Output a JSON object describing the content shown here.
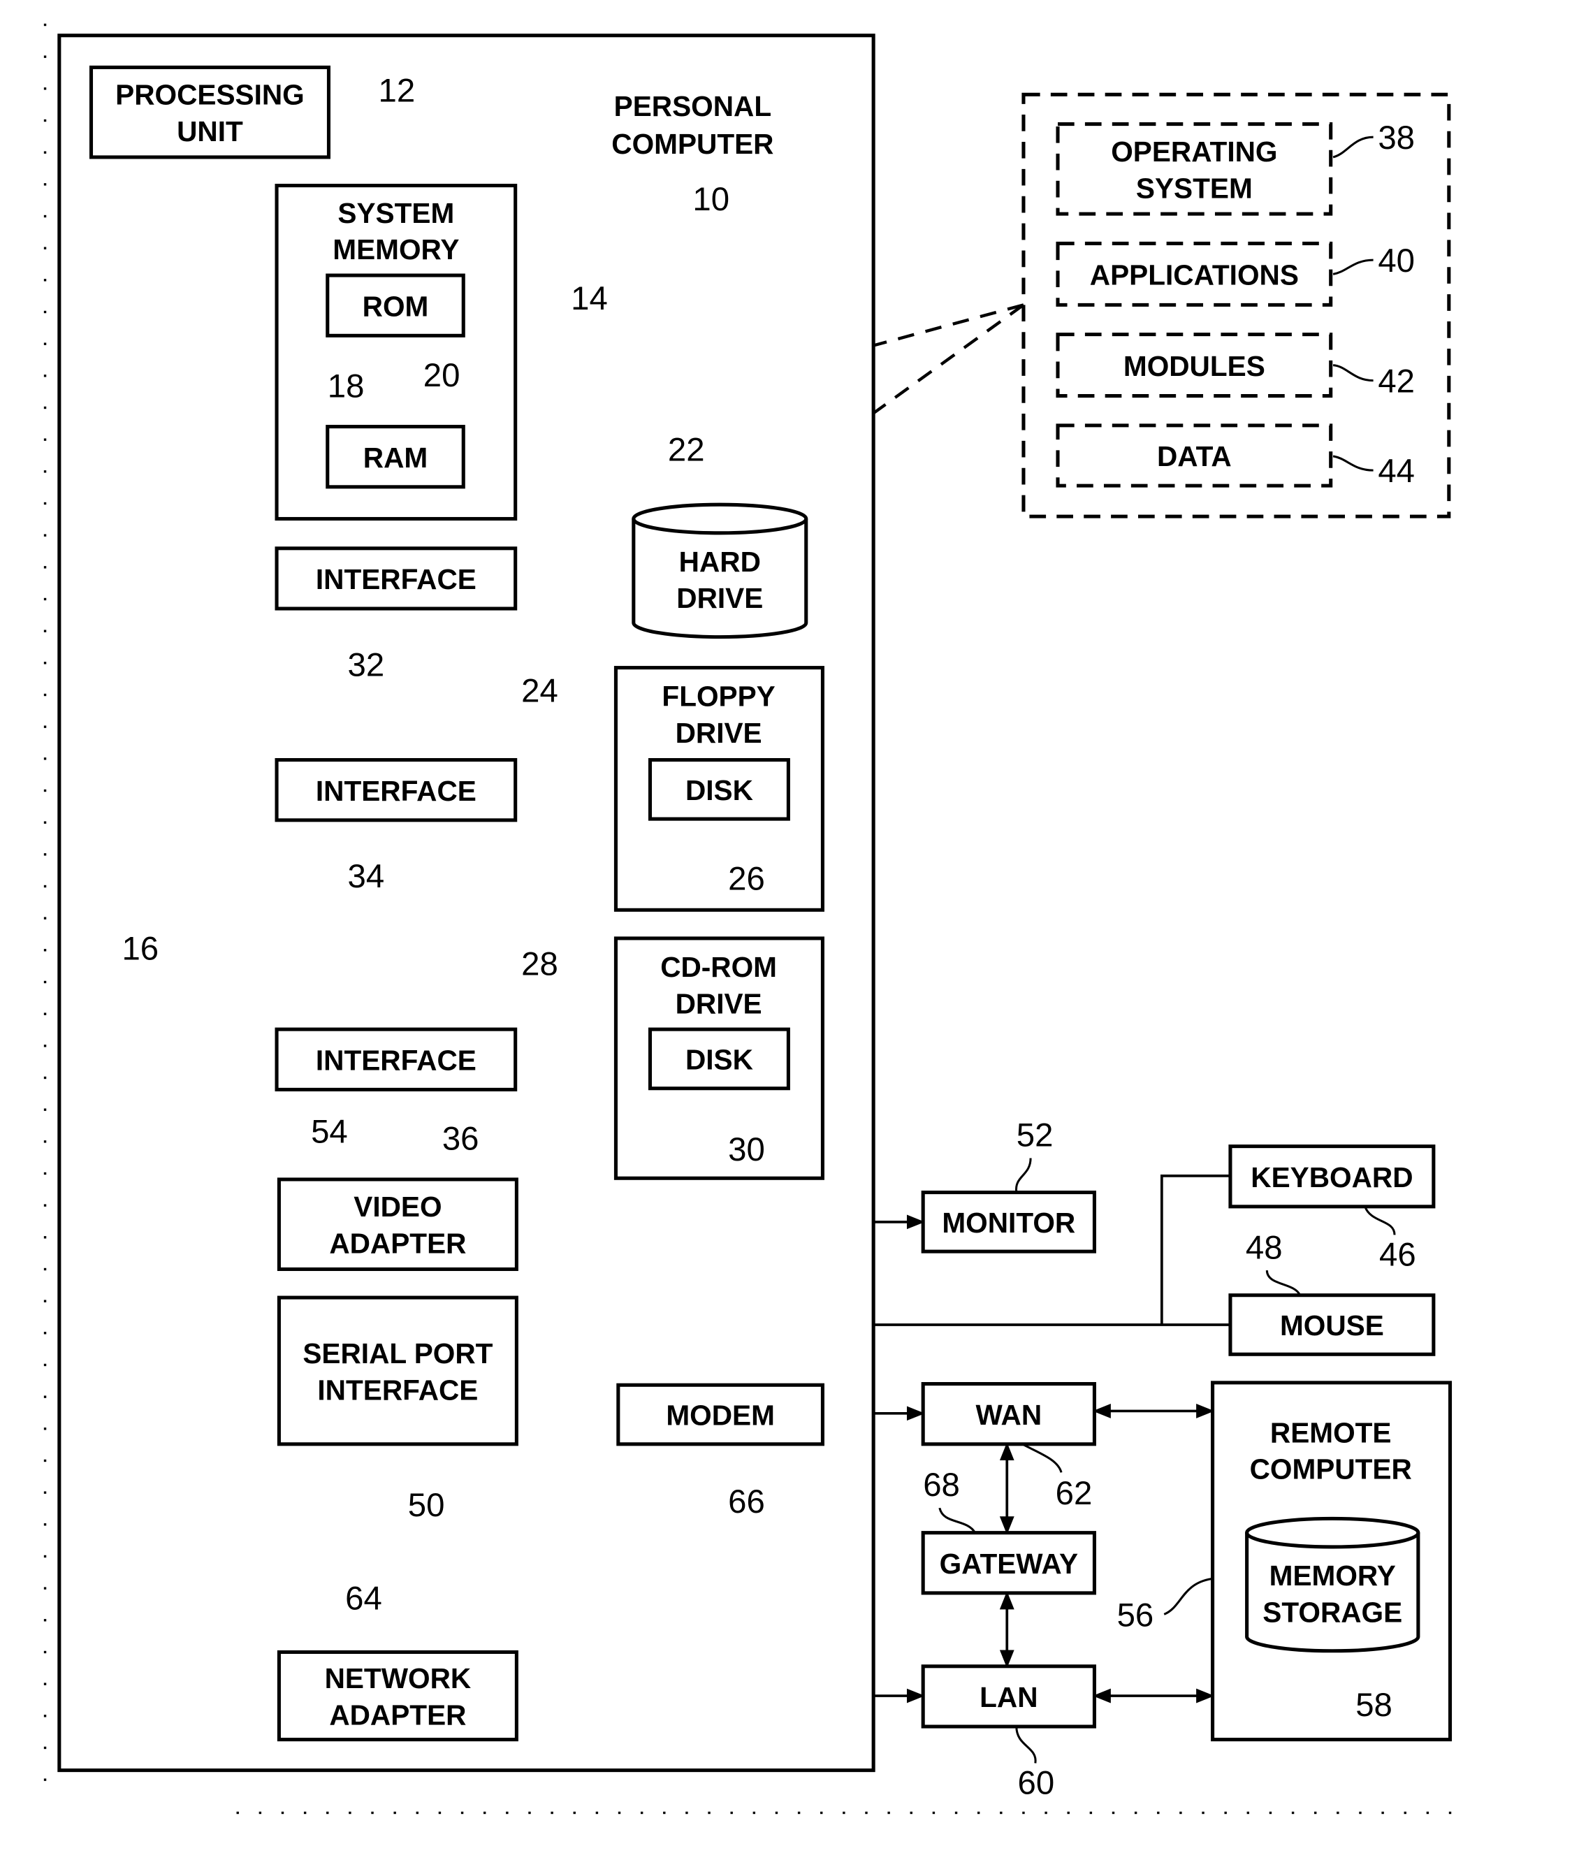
{
  "figure": {
    "title": "PERSONAL COMPUTER",
    "title_ref": "10",
    "blocks": {
      "processing_unit": {
        "label": [
          "PROCESSING",
          "UNIT"
        ],
        "ref": "12"
      },
      "system_memory": {
        "label": [
          "SYSTEM",
          "MEMORY"
        ],
        "ref": "14"
      },
      "rom": {
        "label": [
          "ROM"
        ],
        "ref": "18"
      },
      "ram": {
        "label": [
          "RAM"
        ],
        "ref": "20"
      },
      "system_bus": {
        "ref": "16"
      },
      "hard_drive": {
        "label": [
          "HARD",
          "DRIVE"
        ],
        "ref": "22"
      },
      "interface_hd": {
        "label": [
          "INTERFACE"
        ],
        "ref": "32"
      },
      "floppy_drive": {
        "label": [
          "FLOPPY",
          "DRIVE"
        ],
        "ref": "24"
      },
      "floppy_disk": {
        "label": [
          "DISK"
        ],
        "ref": "26"
      },
      "interface_floppy": {
        "label": [
          "INTERFACE"
        ],
        "ref": "34"
      },
      "cdrom_drive": {
        "label": [
          "CD-ROM",
          "DRIVE"
        ],
        "ref": "28"
      },
      "cdrom_disk": {
        "label": [
          "DISK"
        ],
        "ref": "30"
      },
      "interface_cdrom": {
        "label": [
          "INTERFACE"
        ],
        "ref": "36"
      },
      "video_adapter": {
        "label": [
          "VIDEO",
          "ADAPTER"
        ],
        "ref": "54"
      },
      "monitor": {
        "label": [
          "MONITOR"
        ],
        "ref": "52"
      },
      "serial_port_interface": {
        "label": [
          "SERIAL PORT",
          "INTERFACE"
        ],
        "ref": "50"
      },
      "keyboard": {
        "label": [
          "KEYBOARD"
        ],
        "ref": "46"
      },
      "mouse": {
        "label": [
          "MOUSE"
        ],
        "ref": "48"
      },
      "modem": {
        "label": [
          "MODEM"
        ],
        "ref": "66"
      },
      "wan": {
        "label": [
          "WAN"
        ],
        "ref": "62"
      },
      "gateway": {
        "label": [
          "GATEWAY"
        ],
        "ref": "68"
      },
      "lan": {
        "label": [
          "LAN"
        ],
        "ref": "60"
      },
      "network_adapter": {
        "label": [
          "NETWORK",
          "ADAPTER"
        ],
        "ref": "64"
      },
      "remote_computer": {
        "label": [
          "REMOTE",
          "COMPUTER"
        ],
        "ref": "56"
      },
      "memory_storage": {
        "label": [
          "MEMORY",
          "STORAGE"
        ],
        "ref": "58"
      },
      "operating_system": {
        "label": [
          "OPERATING",
          "SYSTEM"
        ],
        "ref": "38"
      },
      "applications": {
        "label": [
          "APPLICATIONS"
        ],
        "ref": "40"
      },
      "modules": {
        "label": [
          "MODULES"
        ],
        "ref": "42"
      },
      "data": {
        "label": [
          "DATA"
        ],
        "ref": "44"
      }
    }
  }
}
